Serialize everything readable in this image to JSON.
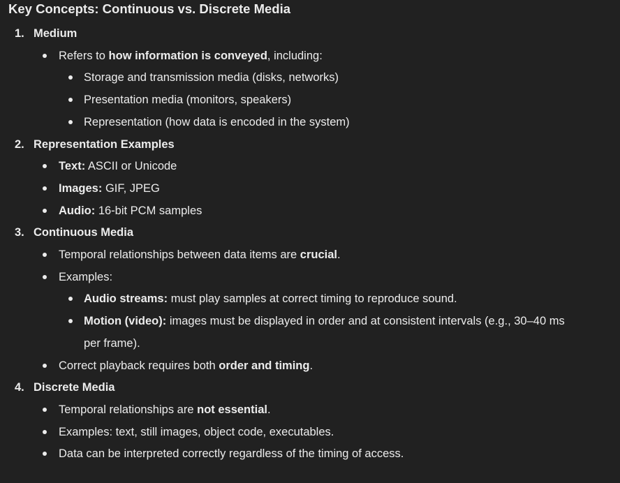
{
  "title": "Key Concepts: Continuous vs. Discrete Media",
  "lines": [
    {
      "kind": "num",
      "level": 0,
      "marker": "1.",
      "segs": [
        {
          "b": true,
          "t": "Medium"
        }
      ]
    },
    {
      "kind": "bullet",
      "level": 1,
      "segs": [
        {
          "t": "Refers to "
        },
        {
          "b": true,
          "t": "how information is conveyed"
        },
        {
          "t": ", including:"
        }
      ]
    },
    {
      "kind": "bullet",
      "level": 2,
      "segs": [
        {
          "t": "Storage and transmission media (disks, networks)"
        }
      ]
    },
    {
      "kind": "bullet",
      "level": 2,
      "segs": [
        {
          "t": "Presentation media (monitors, speakers)"
        }
      ]
    },
    {
      "kind": "bullet",
      "level": 2,
      "segs": [
        {
          "t": "Representation (how data is encoded in the system)"
        }
      ]
    },
    {
      "kind": "num",
      "level": 0,
      "marker": "2.",
      "segs": [
        {
          "b": true,
          "t": "Representation Examples"
        }
      ]
    },
    {
      "kind": "bullet",
      "level": 1,
      "segs": [
        {
          "b": true,
          "t": "Text:"
        },
        {
          "t": " ASCII or Unicode"
        }
      ]
    },
    {
      "kind": "bullet",
      "level": 1,
      "segs": [
        {
          "b": true,
          "t": "Images:"
        },
        {
          "t": " GIF, JPEG"
        }
      ]
    },
    {
      "kind": "bullet",
      "level": 1,
      "segs": [
        {
          "b": true,
          "t": "Audio:"
        },
        {
          "t": " 16-bit PCM samples"
        }
      ]
    },
    {
      "kind": "num",
      "level": 0,
      "marker": "3.",
      "segs": [
        {
          "b": true,
          "t": "Continuous Media"
        }
      ]
    },
    {
      "kind": "bullet",
      "level": 1,
      "segs": [
        {
          "t": "Temporal relationships between data items are "
        },
        {
          "b": true,
          "t": "crucial"
        },
        {
          "t": "."
        }
      ]
    },
    {
      "kind": "bullet",
      "level": 1,
      "segs": [
        {
          "t": "Examples:"
        }
      ]
    },
    {
      "kind": "bullet",
      "level": 2,
      "segs": [
        {
          "b": true,
          "t": "Audio streams:"
        },
        {
          "t": " must play samples at correct timing to reproduce sound."
        }
      ]
    },
    {
      "kind": "bullet",
      "level": 2,
      "segs": [
        {
          "b": true,
          "t": "Motion (video):"
        },
        {
          "t": " images must be displayed in order and at consistent intervals (e.g., 30–40 ms"
        }
      ]
    },
    {
      "kind": "cont",
      "level": 2,
      "segs": [
        {
          "t": "per frame)."
        }
      ]
    },
    {
      "kind": "bullet",
      "level": 1,
      "segs": [
        {
          "t": "Correct playback requires both "
        },
        {
          "b": true,
          "t": "order and timing"
        },
        {
          "t": "."
        }
      ]
    },
    {
      "kind": "num",
      "level": 0,
      "marker": "4.",
      "segs": [
        {
          "b": true,
          "t": "Discrete Media"
        }
      ]
    },
    {
      "kind": "bullet",
      "level": 1,
      "segs": [
        {
          "t": "Temporal relationships are "
        },
        {
          "b": true,
          "t": "not essential"
        },
        {
          "t": "."
        }
      ]
    },
    {
      "kind": "bullet",
      "level": 1,
      "segs": [
        {
          "t": "Examples: text, still images, object code, executables."
        }
      ]
    },
    {
      "kind": "bullet",
      "level": 1,
      "segs": [
        {
          "t": "Data can be interpreted correctly regardless of the timing of access."
        }
      ]
    }
  ]
}
